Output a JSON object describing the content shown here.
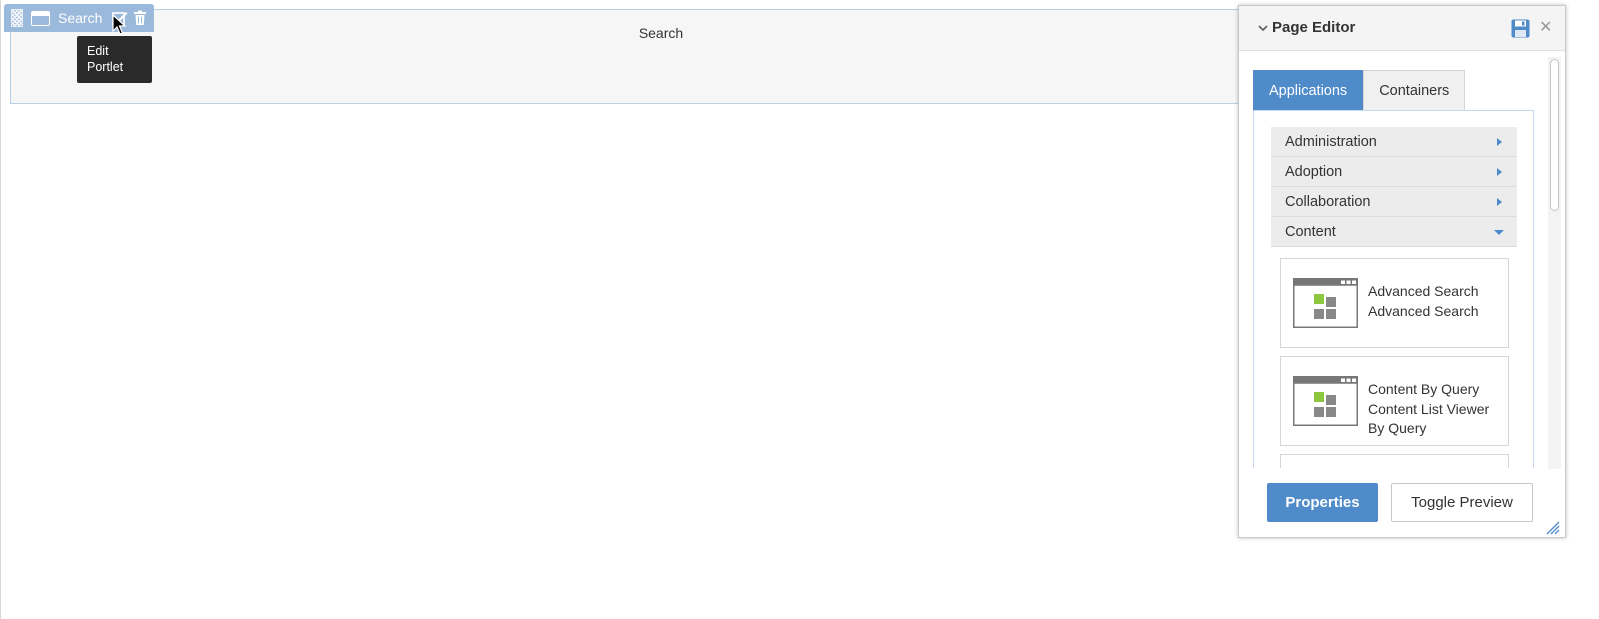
{
  "portlet": {
    "title": "Search",
    "toolbar_label": "Search",
    "tooltip": "Edit Portlet"
  },
  "page_editor": {
    "title": "Page Editor",
    "tabs": [
      {
        "label": "Applications",
        "active": true
      },
      {
        "label": "Containers",
        "active": false
      }
    ],
    "categories": [
      {
        "label": "Administration",
        "expanded": false
      },
      {
        "label": "Adoption",
        "expanded": false
      },
      {
        "label": "Collaboration",
        "expanded": false
      },
      {
        "label": "Content",
        "expanded": true
      }
    ],
    "applications": [
      {
        "name": "Advanced Search",
        "description": "Advanced Search"
      },
      {
        "name": "Content By Query",
        "description": "Content List Viewer By Query"
      }
    ],
    "buttons": {
      "properties": "Properties",
      "toggle_preview": "Toggle Preview"
    }
  },
  "colors": {
    "accent": "#4f8ac9",
    "portlet_bar": "#9bb9db",
    "tooltip_bg": "#2a2a2a"
  },
  "icons": [
    "drag-handle-icon",
    "window-icon",
    "edit-icon",
    "trash-icon",
    "chevron-down-icon",
    "save-icon",
    "close-icon",
    "caret-right-icon",
    "caret-down-icon",
    "application-icon",
    "resize-icon",
    "mouse-cursor-icon"
  ]
}
